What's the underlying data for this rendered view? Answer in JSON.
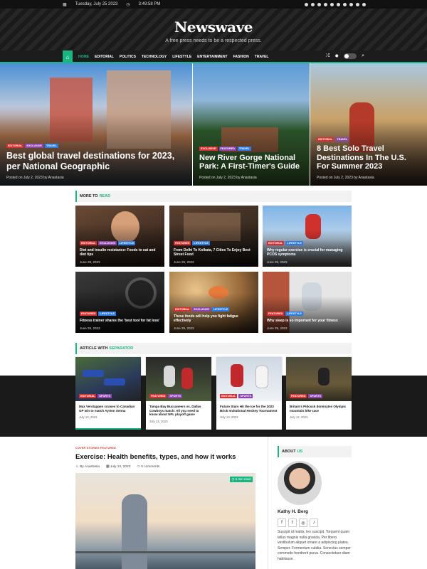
{
  "topbar": {
    "date": "Tuesday, July 25 2023",
    "time": "3:49:58 PM",
    "social_icons": [
      "facebook-icon",
      "instagram-icon",
      "twitter-icon",
      "youtube-icon",
      "linkedin-icon",
      "pinterest-icon",
      "spotify-icon",
      "vk-icon",
      "snapchat-icon",
      "whatsapp-icon"
    ]
  },
  "header": {
    "logo": "Newswave",
    "tagline": "A free press needs to be a respected press."
  },
  "nav": {
    "items": [
      "HOME",
      "EDITORIAL",
      "POLITICS",
      "TECHNOLOGY",
      "LIFESTYLE",
      "ENTERTAINMENT",
      "FASHION",
      "TRAVEL"
    ]
  },
  "hero": [
    {
      "badges": [
        "EDITORIAL",
        "EXCLUSIVE",
        "TRAVEL"
      ],
      "title": "Best global travel destinations for 2023, per National Geographic",
      "meta": "Posted on July 2, 2023     by Anastasia"
    },
    {
      "badges": [
        "EXCLUSIVE",
        "FEATURED",
        "TRAVEL"
      ],
      "title": "New River Gorge National Park: A First-Timer's Guide",
      "meta": "Posted on July 2, 2023     by Anastasia"
    },
    {
      "badges": [
        "EDITORIAL",
        "TRAVEL"
      ],
      "title": "8 Best Solo Travel Destinations In The U.S. For Summer 2023",
      "meta": "Posted on July 2, 2023     by Anastasia"
    }
  ],
  "more_to_read": {
    "heading": "MORE TO",
    "highlight": "READ",
    "cards": [
      {
        "badges": [
          "EDITORIAL",
          "EXCLUSIVE",
          "LIFESTYLE"
        ],
        "title": "Diet and insulin resistance: Foods to eat and diet tips",
        "date": "June 29, 2023"
      },
      {
        "badges": [
          "FEATURED",
          "LIFESTYLE"
        ],
        "title": "From Delhi To Kolkata, 7 Cities To Enjoy Best Street Food",
        "date": "June 29, 2023"
      },
      {
        "badges": [
          "EDITORIAL",
          "LIFESTYLE"
        ],
        "title": "Why regular exercise is crucial for managing PCOS symptoms",
        "date": "June 29, 2023"
      },
      {
        "badges": [
          "FEATURED",
          "LIFESTYLE"
        ],
        "title": "Fitness trainer shares the 'best tool for fat loss'",
        "date": "June 29, 2023"
      },
      {
        "badges": [
          "EDITORIAL",
          "EXCLUSIVE",
          "LIFESTYLE"
        ],
        "title": "These foods will help you fight fatigue effectively",
        "date": "June 29, 2023"
      },
      {
        "badges": [
          "FEATURED",
          "LIFESTYLE"
        ],
        "title": "Why sleep is so important for your fitness",
        "date": "June 29, 2023"
      }
    ]
  },
  "separator": {
    "heading": "ARTICLE WITH",
    "highlight": "SEPARATOR",
    "cards": [
      {
        "badges": [
          "EDITORIAL",
          "SPORTS"
        ],
        "title": "Max Verstappen cruises to Canadian GP win to match Ayrton Senna",
        "date": "July 13, 2023"
      },
      {
        "badges": [
          "FEATURED",
          "SPORTS"
        ],
        "title": "Tampa Bay Buccaneers vs. Dallas Cowboys match: All you need to know about NFL playoff game",
        "date": "July 13, 2023"
      },
      {
        "badges": [
          "EDITORIAL",
          "SPORTS"
        ],
        "title": "Future Stars Hit the Ice for the 2023 Brick Invitational Hockey Tournament",
        "date": "July 13, 2023"
      },
      {
        "badges": [
          "FEATURED",
          "SPORTS"
        ],
        "title": "Britain's Pidcock dominates Olympic mountain bike race",
        "date": "July 12, 2023"
      }
    ]
  },
  "main_post": {
    "cats": "COVER STORIES  FEATURED",
    "title": "Exercise: Health benefits, types, and how it works",
    "author": "By Anastasia",
    "date": "July 13, 2023",
    "comments": "0 comments",
    "read": "5 min read"
  },
  "about": {
    "heading": "ABOUT",
    "highlight": "US",
    "name": "Kathy H. Berg",
    "social": [
      "f",
      "t",
      "◎",
      "♪"
    ],
    "bio": "Suscipit id mattis, leo suscipit. Torquent quam tellus magnis nulla gravida. Per libero vestibulum aliquet ornare a adipiscing platea. Semper. Fermentum cubilia. Senectus semper commodo hendrerit purus. Consectetuer diam habitasse."
  },
  "colors": {
    "accent": "#1bb584",
    "editorial": "#d63031",
    "exclusive": "#8e44ad",
    "travel": "#2d7be5"
  }
}
